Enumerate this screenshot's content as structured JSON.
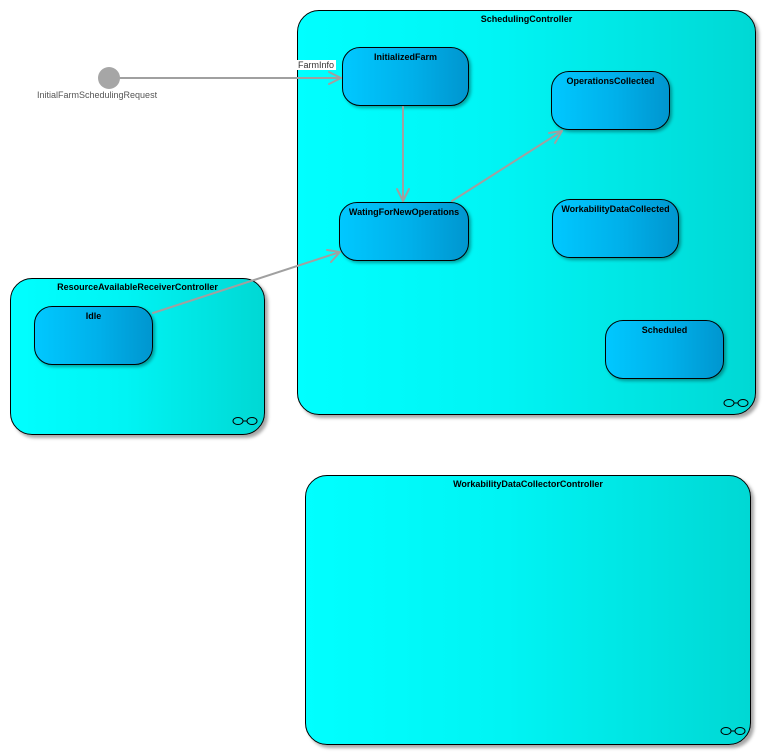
{
  "diagram": {
    "initial_node": {
      "label": "InitialFarmSchedulingRequest"
    },
    "composites": {
      "scheduling": {
        "title": "SchedulingController"
      },
      "resource": {
        "title": "ResourceAvailableReceiverController"
      },
      "workability": {
        "title": "WorkabilityDataCollectorController"
      }
    },
    "states": {
      "initialized_farm": "InitializedFarm",
      "operations_collected": "OperationsCollected",
      "waiting_for_new_operations": "WatingForNewOperations",
      "workability_data_collected": "WorkabilityDataCollected",
      "scheduled": "Scheduled",
      "idle": "Idle"
    },
    "transitions": [
      {
        "from": "InitialFarmSchedulingRequest",
        "to": "InitializedFarm",
        "label": "FarmInfo"
      },
      {
        "from": "InitializedFarm",
        "to": "WatingForNewOperations",
        "label": ""
      },
      {
        "from": "WatingForNewOperations",
        "to": "OperationsCollected",
        "label": ""
      },
      {
        "from": "Idle",
        "to": "WatingForNewOperations",
        "label": ""
      }
    ],
    "colors": {
      "composite_fill": "#00ffff",
      "state_fill": "#00c8ff",
      "edge": "#a0a0a0",
      "initial_node": "#a6a6a6"
    }
  }
}
